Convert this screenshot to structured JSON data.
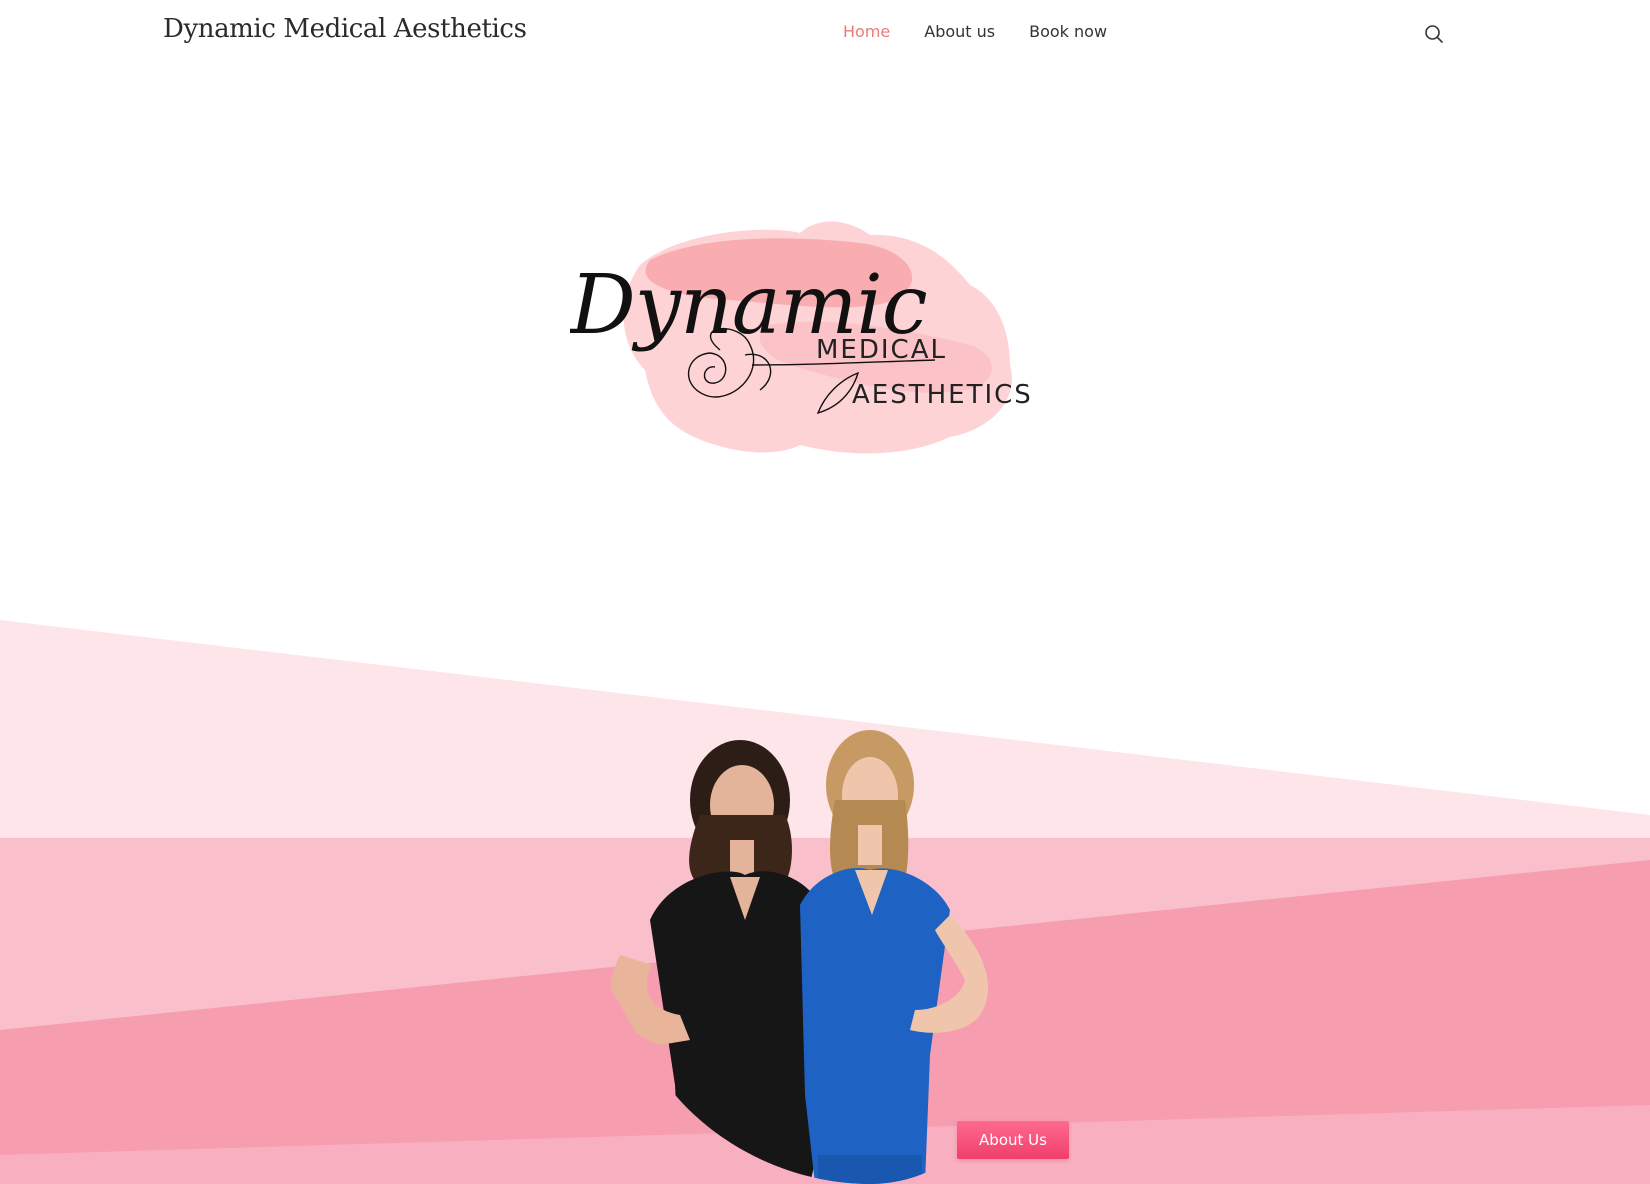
{
  "header": {
    "site_title": "Dynamic Medical Aesthetics",
    "nav": [
      {
        "label": "Home",
        "active": true
      },
      {
        "label": "About us",
        "active": false
      },
      {
        "label": "Book now",
        "active": false
      }
    ],
    "search_icon": "search-icon"
  },
  "hero": {
    "logo": {
      "script_word": "Dynamic",
      "line1": "MEDICAL",
      "line2": "AESTHETICS",
      "icon": "rose-line-icon"
    },
    "photo_alt": "team-photo",
    "cta_label": "About Us"
  },
  "colors": {
    "nav_active": "#ec7a7a",
    "band_light": "#fde5e9",
    "band_mid": "#f9b9c5",
    "band_dark": "#f78fa3",
    "button": "#f04e76"
  }
}
